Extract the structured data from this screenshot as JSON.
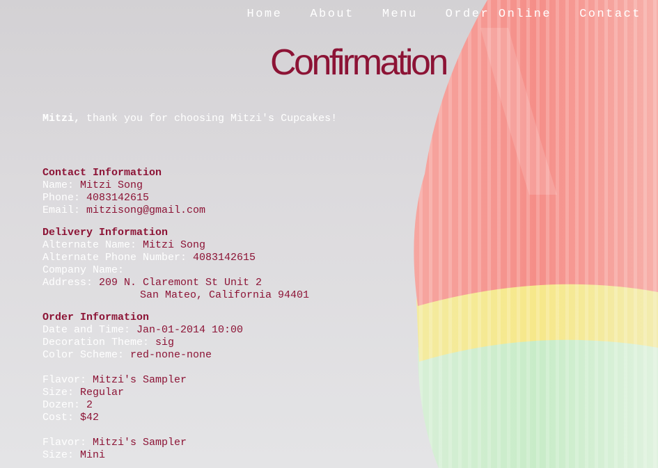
{
  "nav": {
    "items": [
      {
        "label": "Home"
      },
      {
        "label": "About"
      },
      {
        "label": "Menu"
      },
      {
        "label": "Order Online"
      },
      {
        "label": "Contact"
      }
    ]
  },
  "page_title": "Confirmation",
  "thanks": {
    "name": "Mitzi,",
    "message": " thank you for choosing Mitzi's Cupcakes!"
  },
  "contact": {
    "heading": "Contact Information",
    "name_label": "Name: ",
    "name": "Mitzi Song",
    "phone_label": "Phone: ",
    "phone": "4083142615",
    "email_label": "Email: ",
    "email": "mitzisong@gmail.com"
  },
  "delivery": {
    "heading": "Delivery Information",
    "alt_name_label": "Alternate Name: ",
    "alt_name": "Mitzi Song",
    "alt_phone_label": "Alternate Phone Number: ",
    "alt_phone": "4083142615",
    "company_label": "Company Name:",
    "address_label": "Address: ",
    "address_line1": "209 N. Claremont St Unit 2",
    "address_line2": "San Mateo, California 94401"
  },
  "order": {
    "heading": "Order Information",
    "datetime_label": "Date and Time: ",
    "datetime": "Jan-01-2014 10:00",
    "theme_label": "Decoration Theme: ",
    "theme": "sig",
    "scheme_label": "Color Scheme: ",
    "scheme": "red-none-none",
    "items": [
      {
        "flavor_label": "Flavor: ",
        "flavor": "Mitzi's Sampler",
        "size_label": "Size: ",
        "size": "Regular",
        "dozen_label": "Dozen: ",
        "dozen": "2",
        "cost_label": "Cost: ",
        "cost": "$42"
      },
      {
        "flavor_label": "Flavor: ",
        "flavor": "Mitzi's Sampler",
        "size_label": "Size: ",
        "size": "Mini"
      }
    ]
  },
  "colors": {
    "accent": "#8c1335",
    "text": "#ffffff",
    "background": "#d8d6d9"
  },
  "background_image": "stacked-cupcake-liners-photo"
}
